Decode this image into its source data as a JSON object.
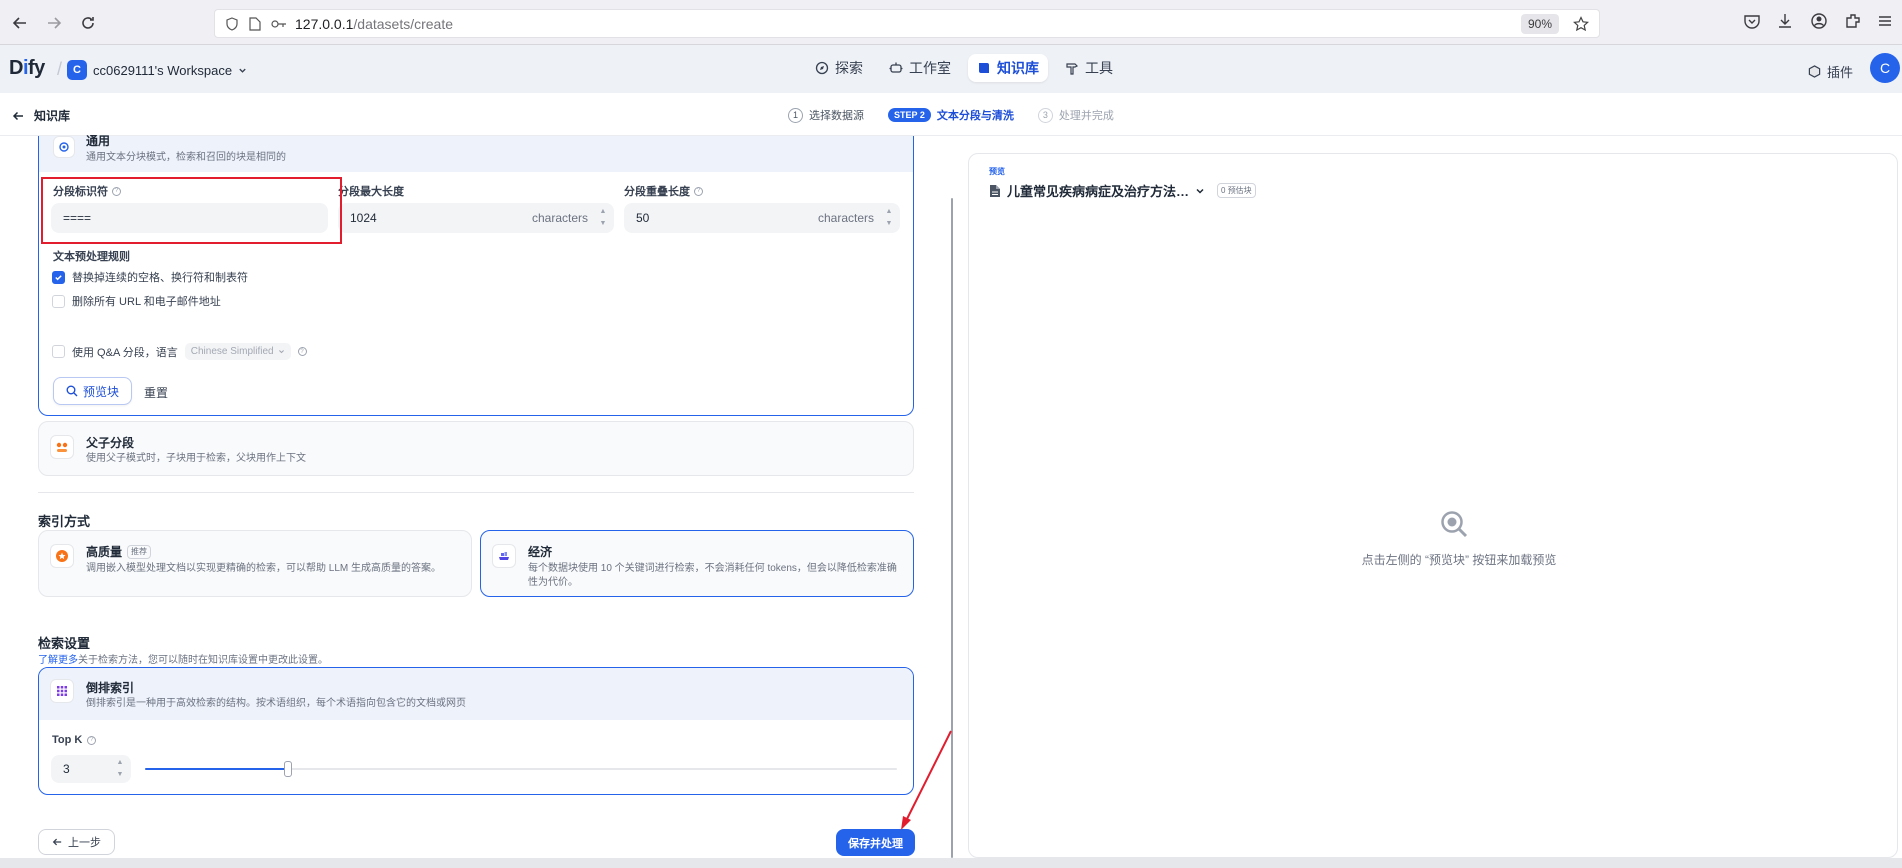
{
  "browser": {
    "url_host": "127.0.0.1",
    "url_path": "/datasets/create",
    "zoom": "90%"
  },
  "header": {
    "logo": "Dify",
    "workspace_initial": "C",
    "workspace_name": "cc0629111's Workspace",
    "nav": [
      "探索",
      "工作室",
      "知识库",
      "工具"
    ],
    "plugins_label": "插件",
    "user_initial": "C"
  },
  "steps": {
    "back_label": "知识库",
    "step1_num": "1",
    "step1_label": "选择数据源",
    "step2_pill": "STEP 2",
    "step2_label": "文本分段与清洗",
    "step3_num": "3",
    "step3_label": "处理并完成"
  },
  "general": {
    "title": "通用",
    "desc": "通用文本分块模式，检索和召回的块是相同的",
    "delimiter_label": "分段标识符",
    "delimiter_value": "====",
    "max_len_label": "分段最大长度",
    "max_len_value": "1024",
    "overlap_label": "分段重叠长度",
    "overlap_value": "50",
    "unit": "characters",
    "rules_title": "文本预处理规则",
    "rule1": "替换掉连续的空格、换行符和制表符",
    "rule1_checked": true,
    "rule2": "删除所有 URL 和电子邮件地址",
    "rule2_checked": false,
    "qa_label": "使用 Q&A 分段，语言",
    "qa_lang": "Chinese Simplified",
    "preview_btn": "预览块",
    "reset_btn": "重置"
  },
  "parent_child": {
    "title": "父子分段",
    "desc": "使用父子模式时，子块用于检索，父块用作上下文"
  },
  "index": {
    "heading": "索引方式",
    "hq_title": "高质量",
    "hq_badge": "推荐",
    "hq_desc": "调用嵌入模型处理文档以实现更精确的检索，可以帮助 LLM 生成高质量的答案。",
    "eco_title": "经济",
    "eco_desc_1": "每个数据块使用 10 个关键词进行检索，不会消耗任何 tokens，但会以降低检索准确",
    "eco_desc_2": "性为代价。"
  },
  "retrieval": {
    "heading": "检索设置",
    "hint_link": "了解更多",
    "hint_text": "关于检索方法，您可以随时在知识库设置中更改此设置。",
    "title": "倒排索引",
    "desc": "倒排索引是一种用于高效检索的结构。按术语组织，每个术语指向包含它的文档或网页",
    "topk_label": "Top K",
    "topk_value": "3",
    "topk_level": 0.19
  },
  "footer": {
    "prev_btn": "上一步",
    "save_btn": "保存并处理"
  },
  "preview": {
    "label": "预览",
    "doc_name": "儿童常见疾病病症及治疗方法…",
    "count": "0 预估块",
    "empty_text": "点击左侧的 “预览块” 按钮来加载预览"
  },
  "colors": {
    "accent": "#2563eb",
    "annotation_red": "#e11d2e"
  }
}
